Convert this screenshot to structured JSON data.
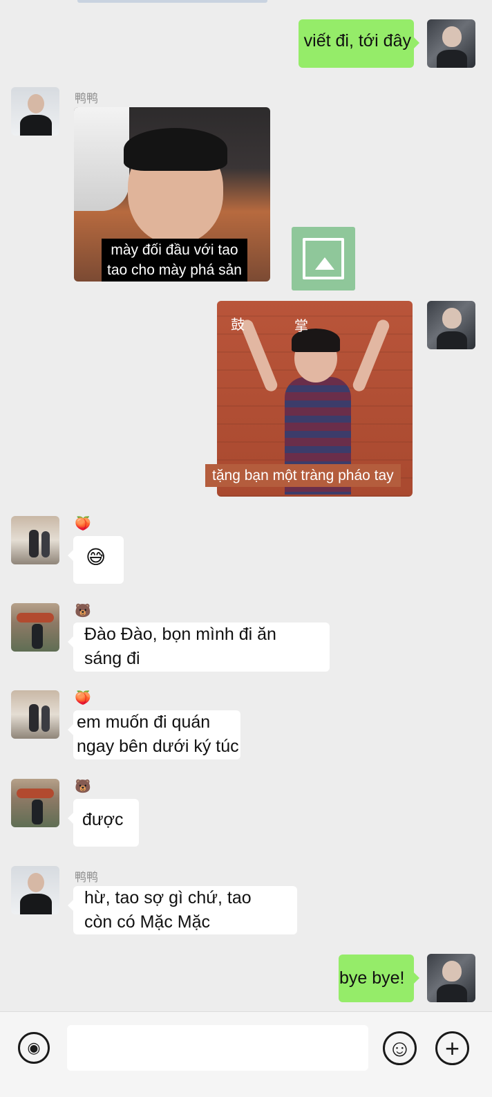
{
  "chat": {
    "messages": [
      {
        "id": "m1",
        "text": "viết đi, tới đây"
      },
      {
        "id": "m2",
        "sender": "鸭鸭",
        "sticker_caption_line1": "mày đối đầu với tao",
        "sticker_caption_line2": "tao cho mày phá sản"
      },
      {
        "id": "m3",
        "sticker_chars": [
          "鼓",
          "掌"
        ],
        "sticker_caption": "tặng bạn một tràng pháo tay"
      },
      {
        "id": "m4",
        "sender_emoji": "🍑",
        "text": "😅"
      },
      {
        "id": "m5",
        "sender_emoji": "🐻",
        "line1": "Đào Đào, bọn mình đi ăn",
        "line2": "sáng đi"
      },
      {
        "id": "m6",
        "sender_emoji": "🍑",
        "line1": "em muốn đi quán",
        "line2": "ngay bên dưới ký túc"
      },
      {
        "id": "m7",
        "sender_emoji": "🐻",
        "text": "được"
      },
      {
        "id": "m8",
        "sender": "鸭鸭",
        "line1": "hừ, tao sợ gì chứ, tao",
        "line2": "còn có Mặc Mặc"
      },
      {
        "id": "m9",
        "text": "bye bye!"
      }
    ]
  },
  "input_bar": {
    "voice_icon": "voice-wave-icon",
    "text_value": "",
    "emoji_icon": "smiley-icon",
    "plus_icon": "plus-icon",
    "plus_glyph": "+",
    "smiley_glyph": "☺",
    "voice_glyph": "◉"
  },
  "colors": {
    "background": "#ededed",
    "outgoing_bubble": "#95ec69",
    "incoming_bubble": "#ffffff"
  }
}
